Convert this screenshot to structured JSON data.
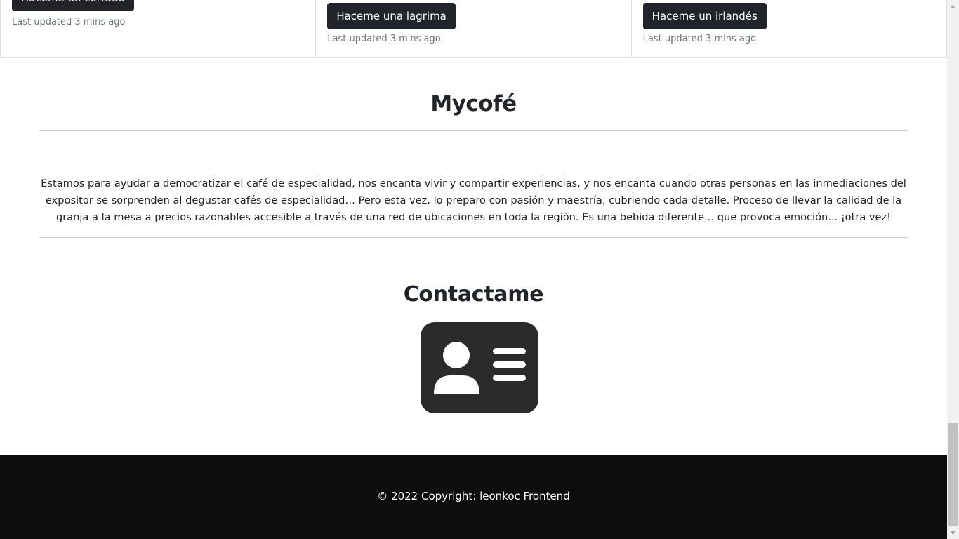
{
  "cards": [
    {
      "button_label": "Haceme un cortado",
      "updated": "Last updated 3 mins ago"
    },
    {
      "button_label": "Haceme una lagrima",
      "updated": "Last updated 3 mins ago"
    },
    {
      "button_label": "Haceme un irlandés",
      "updated": "Last updated 3 mins ago"
    }
  ],
  "about": {
    "title": "Mycofé",
    "text": "Estamos para ayudar a democratizar el café de especialidad, nos encanta vivir y compartir experiencias, y nos encanta cuando otras personas en las inmediaciones del expositor se sorprenden al degustar cafés de especialidad… Pero esta vez, lo preparo con pasión y maestría, cubriendo cada detalle. Proceso de llevar la calidad de la granja a la mesa a precios razonables accesible a través de una red de ubicaciones en toda la región. Es una bebida diferente... que provoca emoción... ¡otra vez!"
  },
  "contact": {
    "title": "Contactame",
    "icon": "contact-card-icon",
    "icon_color": "#2b2b2b"
  },
  "footer": {
    "text": "© 2022 Copyright: leonkoc Frontend",
    "background": "#0d0d0f"
  },
  "scrollbar": {
    "position_fraction": 0.96
  }
}
